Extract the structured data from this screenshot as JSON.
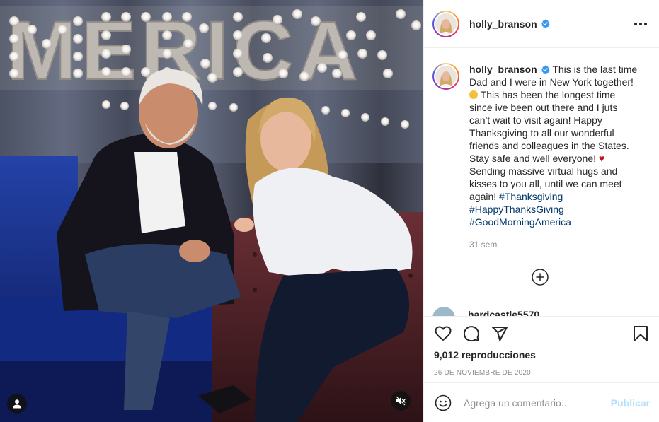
{
  "post": {
    "username": "holly_branson",
    "verified": true,
    "caption_lines": [
      "This is the last time",
      "Dad and I were in New York together!",
      "This has been the longest time",
      "since ive been out there and I juts",
      "can't wait to visit again! Happy",
      "Thanksgiving to all our wonderful",
      "friends and colleagues in the States.",
      "Stay safe and well everyone!",
      "Sending massive virtual hugs and",
      "kisses to you all, until we can meet",
      "again!"
    ],
    "hashtags": [
      "#Thanksgiving",
      "#HappyThanksGiving",
      "#GoodMorningAmerica"
    ],
    "time_ago": "31 sem",
    "views": "9,012 reproducciones",
    "date": "26 DE NOVIEMBRE DE 2020",
    "next_comment_user": "hardcastle5570"
  },
  "media": {
    "sign_text": "MERICA"
  },
  "comment_box": {
    "placeholder": "Agrega un comentario...",
    "publish_label": "Publicar"
  },
  "icons": {
    "more": "more-options-icon",
    "like": "heart-icon",
    "comment": "comment-bubble-icon",
    "share": "paper-plane-icon",
    "save": "bookmark-icon",
    "emoji": "smiley-icon",
    "load_more": "plus-circle-icon",
    "mute": "speaker-muted-icon",
    "tagged_user": "user-icon",
    "verified": "verified-badge-icon"
  },
  "colors": {
    "verified_blue": "#3897f0",
    "hashtag": "#00376b",
    "muted_text": "#8e8e8e",
    "publish_disabled": "#b2dffc",
    "heart_emoji": "#c0151d"
  }
}
